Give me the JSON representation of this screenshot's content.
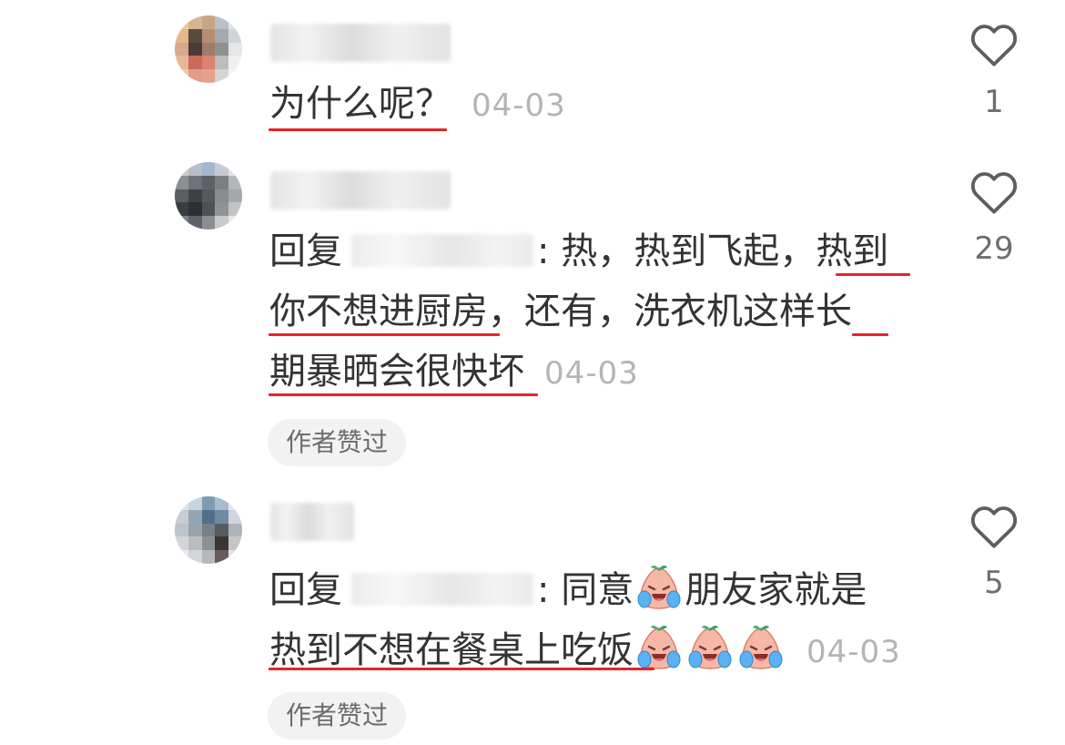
{
  "comments": [
    {
      "text_lines": [
        "为什么呢？"
      ],
      "time": "04-03",
      "likes": "1"
    },
    {
      "reply_label": "回复",
      "text_line_1": ": 热，热到飞起，热到",
      "text_line_2": "你不想进厨房，还有，洗衣机这样长",
      "text_line_3": "期暴晒会很快坏",
      "time": "04-03",
      "likes": "29",
      "badge": "作者赞过"
    },
    {
      "reply_label": "回复",
      "text_line_1": ": 同意",
      "text_line_1b": "朋友家就是",
      "text_line_2": "热到不想在餐桌上吃饭",
      "time": "04-03",
      "likes": "5",
      "badge": "作者赞过"
    }
  ],
  "colors": {
    "underline": "#e8222b",
    "time": "#b4b4b4",
    "badge_bg": "#f2f2f2"
  },
  "icons": {
    "like": "heart-outline-icon",
    "emoji": "crying-laughing-peach-emoji"
  }
}
